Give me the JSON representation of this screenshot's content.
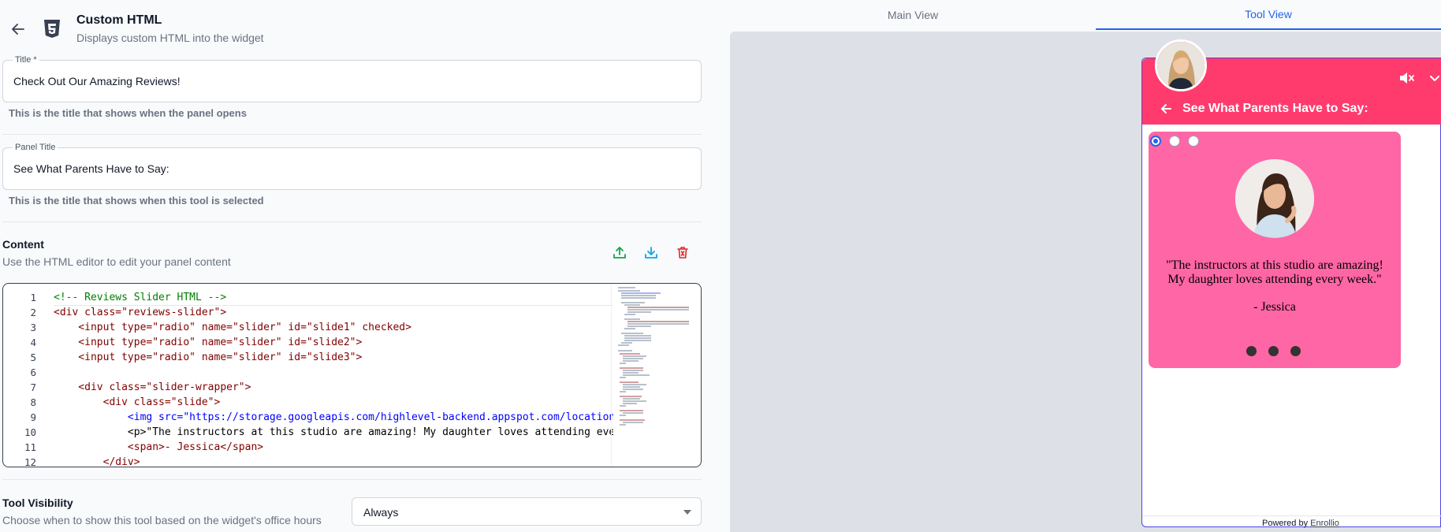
{
  "header": {
    "title": "Custom HTML",
    "subtitle": "Displays custom HTML into the widget"
  },
  "fields": {
    "title": {
      "label": "Title *",
      "value": "Check Out Our Amazing Reviews!",
      "hint": "This is the title that shows when the panel opens"
    },
    "panel_title": {
      "label": "Panel Title",
      "value": "See What Parents Have to Say:",
      "hint": "This is the title that shows when this tool is selected"
    }
  },
  "content": {
    "title": "Content",
    "subtitle": "Use the HTML editor to edit your panel content",
    "actions": [
      "upload-icon",
      "download-icon",
      "delete-icon"
    ],
    "editor": {
      "line_numbers": [
        "1",
        "2",
        "3",
        "4",
        "5",
        "6",
        "7",
        "8",
        "9",
        "10",
        "11",
        "12"
      ],
      "lines": [
        "<!-- Reviews Slider HTML -->",
        "<div class=\"reviews-slider\">",
        "    <input type=\"radio\" name=\"slider\" id=\"slide1\" checked>",
        "    <input type=\"radio\" name=\"slider\" id=\"slide2\">",
        "    <input type=\"radio\" name=\"slider\" id=\"slide3\">",
        "",
        "    <div class=\"slider-wrapper\">",
        "        <div class=\"slide\">",
        "            <img src=\"https://storage.googleapis.com/highlevel-backend.appspot.com/location/",
        "            <p>\"The instructors at this studio are amazing! My daughter loves attending ever",
        "            <span>- Jessica</span>",
        "        </div>"
      ]
    }
  },
  "visibility": {
    "title": "Tool Visibility",
    "subtitle": "Choose when to show this tool based on the widget's office hours",
    "selected": "Always"
  },
  "tabs": {
    "main": "Main View",
    "tool": "Tool View"
  },
  "widget": {
    "panel_title": "See What Parents Have to Say:",
    "quote": "\"The instructors at this studio are amazing! My daughter loves attending every week.\"",
    "author": "- Jessica",
    "slide_count": 3,
    "active_slide": 1,
    "powered_by": "Powered by",
    "brand": "Enrollio",
    "colors": {
      "header": "#ff3b6e",
      "card": "#ff66a6",
      "accent": "#2563eb"
    }
  }
}
